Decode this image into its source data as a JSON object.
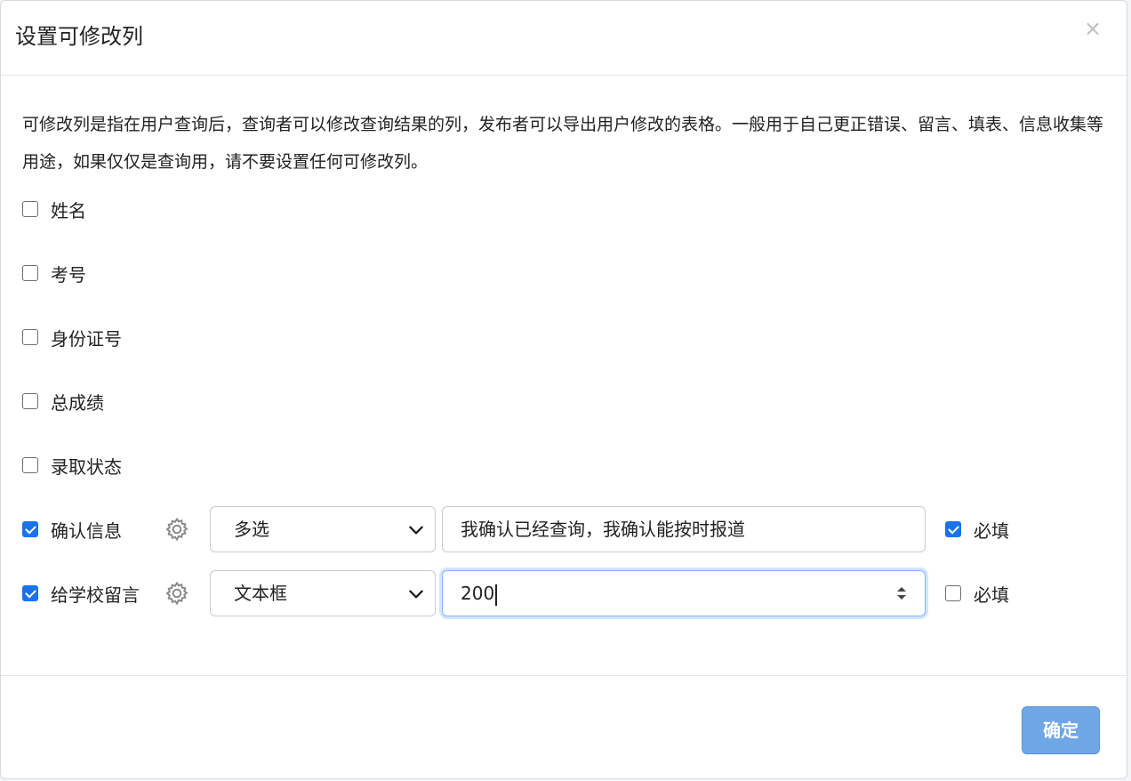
{
  "dialog": {
    "title": "设置可修改列",
    "close_label": "×",
    "description": "可修改列是指在用户查询后，查询者可以修改查询结果的列，发布者可以导出用户修改的表格。一般用于自己更正错误、留言、填表、信息收集等用途，如果仅仅是查询用，请不要设置任何可修改列。"
  },
  "columns": [
    {
      "label": "姓名",
      "checked": false
    },
    {
      "label": "考号",
      "checked": false
    },
    {
      "label": "身份证号",
      "checked": false
    },
    {
      "label": "总成绩",
      "checked": false
    },
    {
      "label": "录取状态",
      "checked": false
    },
    {
      "label": "确认信息",
      "checked": true,
      "icon": "gear-icon",
      "type_value": "多选",
      "input_value": "我确认已经查询，我确认能按时报道",
      "required_label": "必填",
      "required_checked": true
    },
    {
      "label": "给学校留言",
      "checked": true,
      "icon": "gear-icon",
      "type_value": "文本框",
      "input_value": "200",
      "required_label": "必填",
      "required_checked": false
    }
  ],
  "footer": {
    "ok_label": "确定"
  },
  "colors": {
    "primary_checkbox": "#1a73e8",
    "ok_button": "#6fa6e6",
    "focus_ring": "#86b7fe"
  }
}
